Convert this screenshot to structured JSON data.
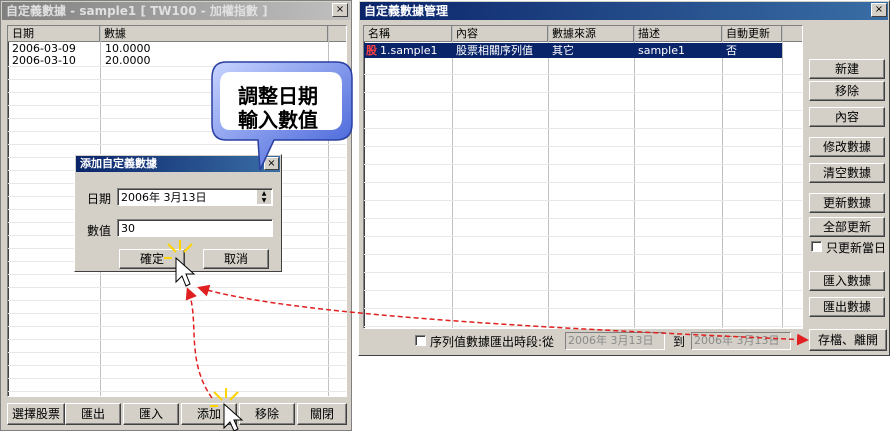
{
  "left_window": {
    "title": "自定義數據 - sample1 [ TW100 - 加權指數 ]",
    "close_icon": "×",
    "columns": [
      "日期",
      "數據"
    ],
    "rows": [
      {
        "date": "2006-03-09",
        "value": "10.0000"
      },
      {
        "date": "2006-03-10",
        "value": "20.0000"
      }
    ],
    "buttons": {
      "select_stock": "選擇股票",
      "export": "匯出",
      "import": "匯入",
      "add": "添加",
      "delete": "移除",
      "close": "關閉"
    }
  },
  "dialog": {
    "title": "添加自定義數據",
    "close_icon": "×",
    "date_label": "日期",
    "date_value": "2006年  3月13日",
    "value_label": "數值",
    "value_input": "30",
    "ok": "確定",
    "cancel": "取消"
  },
  "callout": {
    "line1": "調整日期",
    "line2": "輸入數值"
  },
  "right_window": {
    "title": "自定義數據管理",
    "close_icon": "×",
    "columns": [
      "名稱",
      "內容",
      "數據來源",
      "描述",
      "自動更新"
    ],
    "rows": [
      {
        "icon_text": "股",
        "name": "1.sample1",
        "content": "股票相關序列值",
        "source": "其它",
        "desc": "sample1",
        "auto": "否"
      }
    ],
    "buttons": {
      "new": "新建",
      "remove": "移除",
      "content": "內容",
      "modify": "修改數據",
      "clear": "清空數據",
      "update": "更新數據",
      "update_all": "全部更新",
      "import": "匯入數據",
      "export": "匯出數據",
      "save_exit": "存檔、離開"
    },
    "only_today": "只更新當日",
    "export_range_label": "序列值數據匯出時段:從",
    "date_from": "2006年  3月13日",
    "to_label": "到",
    "date_to": "2006年  3月13日"
  },
  "colors": {
    "title_active": "#0a246a",
    "selection": "#0a246a",
    "callout": "#3b5bd6",
    "arrow": "#e02020"
  }
}
